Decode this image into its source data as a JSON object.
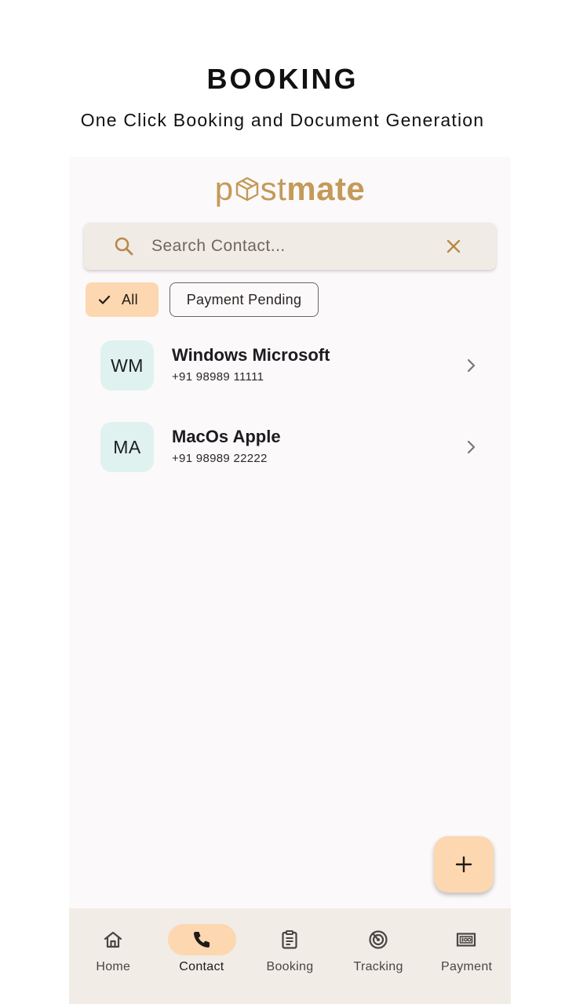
{
  "promo": {
    "title": "BOOKING",
    "subtitle": "One Click Booking and Document Generation"
  },
  "app": {
    "logo_light": "p",
    "logo_light2": "st",
    "logo_bold": "mate",
    "brand_color": "#c39a58",
    "accent_color": "#fcd7b0"
  },
  "search": {
    "placeholder": "Search Contact...",
    "value": ""
  },
  "filters": {
    "all_label": "All",
    "pending_label": "Payment Pending",
    "selected": "All"
  },
  "contacts": [
    {
      "initials": "WM",
      "name": "Windows Microsoft",
      "phone": "+91 98989 11111"
    },
    {
      "initials": "MA",
      "name": "MacOs Apple",
      "phone": "+91 98989 22222"
    }
  ],
  "fab": {
    "icon": "plus-icon"
  },
  "nav": {
    "items": [
      {
        "label": "Home",
        "icon": "home-icon"
      },
      {
        "label": "Contact",
        "icon": "phone-icon"
      },
      {
        "label": "Booking",
        "icon": "clipboard-icon"
      },
      {
        "label": "Tracking",
        "icon": "radar-icon"
      },
      {
        "label": "Payment",
        "icon": "payment-icon"
      }
    ],
    "active": "Contact"
  }
}
